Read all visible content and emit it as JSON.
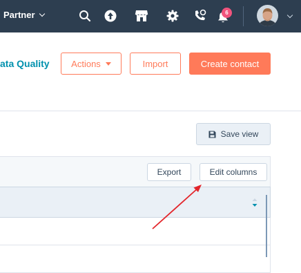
{
  "topbar": {
    "account_label": "Partner",
    "notification_count": "6",
    "icons": [
      "search-icon",
      "upgrade-icon",
      "marketplace-icon",
      "settings-icon",
      "calling-icon",
      "notifications-icon"
    ]
  },
  "header": {
    "title_fragment": "ata Quality",
    "actions_label": "Actions",
    "import_label": "Import",
    "create_label": "Create contact"
  },
  "view": {
    "save_view_label": "Save view"
  },
  "table": {
    "export_label": "Export",
    "edit_columns_label": "Edit columns"
  },
  "colors": {
    "nav_bg": "#2d3e50",
    "accent": "#ff7a59",
    "link": "#0091ae",
    "badge": "#f2547d",
    "annotation_arrow": "#e3262b"
  }
}
